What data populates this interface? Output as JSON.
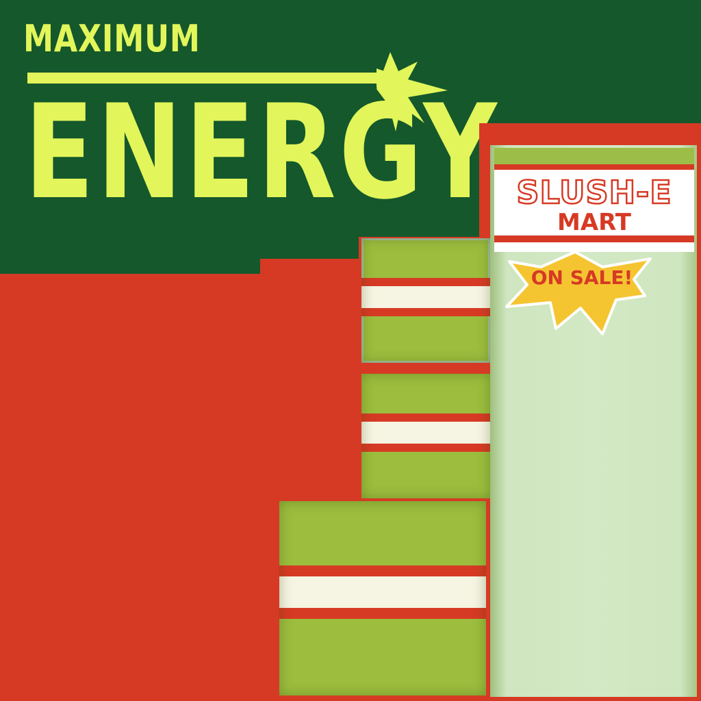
{
  "title": {
    "small": "MAXIMUM",
    "big": "ENERGY"
  },
  "store_sign": {
    "line1": "SLUSH-E",
    "line2": "MART"
  },
  "badge": {
    "label": "ON SALE!",
    "icon": "starburst-icon"
  },
  "colors": {
    "background_red": "#d63a24",
    "dark_green": "#14582c",
    "lime_text": "#e2f55a",
    "can_green": "#9cbd3e",
    "can_band": "#f6f4e2",
    "burst_yellow": "#f5c531",
    "panel_green": "#d3e8c4"
  },
  "cans": [
    {
      "name": "can-small-top"
    },
    {
      "name": "can-small-middle"
    },
    {
      "name": "can-large-bottom"
    }
  ]
}
